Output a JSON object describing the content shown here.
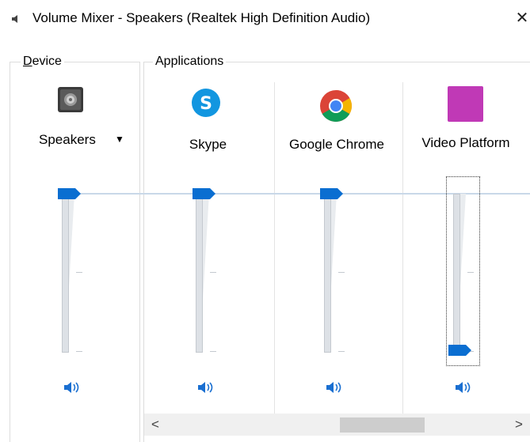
{
  "window": {
    "title": "Volume Mixer - Speakers (Realtek High Definition Audio)",
    "icon": "speaker-icon",
    "close_glyph": "✕"
  },
  "device": {
    "group_label": "Device",
    "accelerator_letter": "D",
    "name": "Speakers",
    "icon": "speaker-device-icon",
    "dropdown_glyph": "▼",
    "volume_level": 1.0
  },
  "applications": {
    "group_label": "Applications",
    "items": [
      {
        "name": "Skype",
        "icon": "skype-icon",
        "color": "#1296e0",
        "volume_level": 1.0
      },
      {
        "name": "Google Chrome",
        "icon": "chrome-icon",
        "color": "#db4437",
        "volume_level": 1.0
      },
      {
        "name": "Video Platform",
        "icon": "video-platform-icon",
        "color": "#c039b6",
        "volume_level": 0.0
      }
    ]
  },
  "mute_icon": "speaker-volume-icon",
  "colors": {
    "accent": "#0a6ed1",
    "thumb": "#0a6ed1"
  },
  "scrollbar": {
    "left_glyph": "<",
    "right_glyph": ">"
  }
}
